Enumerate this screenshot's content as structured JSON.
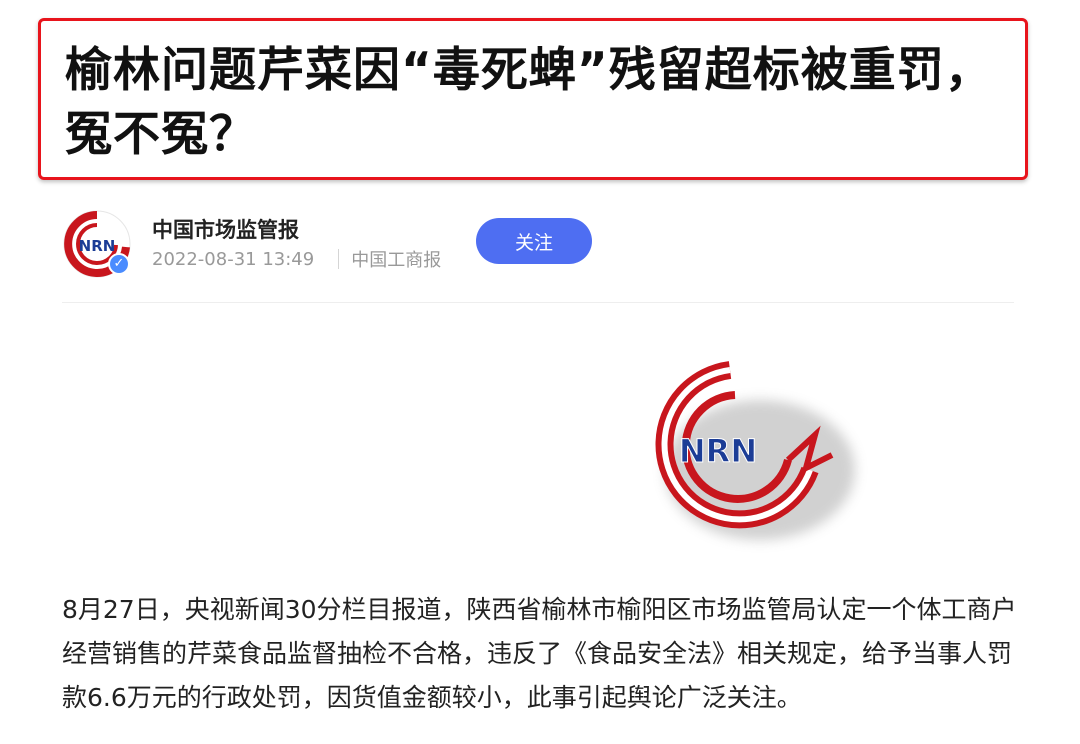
{
  "article": {
    "title": "榆林问题芹菜因“毒死蜱”残留超标被重罚，冤不冤？",
    "body": "8月27日，央视新闻30分栏目报道，陕西省榆林市榆阳区市场监管局认定一个体工商户经营销售的芹菜食品监督抽检不合格，违反了《食品安全法》相关规定，给予当事人罚款6.6万元的行政处罚，因货值金额较小，此事引起舆论广泛关注。"
  },
  "author": {
    "name": "中国市场监管报",
    "timestamp": "2022-08-31 13:49",
    "source": "中国工商报",
    "avatar_icon": "csrn-logo",
    "verified_icon": "verified-badge-icon"
  },
  "actions": {
    "follow_label": "关注"
  },
  "hero_image": {
    "logo_letters": "NRN"
  },
  "colors": {
    "title_border": "#e8141c",
    "follow_button": "#4e6ef2",
    "verified": "#4a8cff",
    "logo_red": "#c8161d",
    "logo_blue": "#1c3d96"
  }
}
